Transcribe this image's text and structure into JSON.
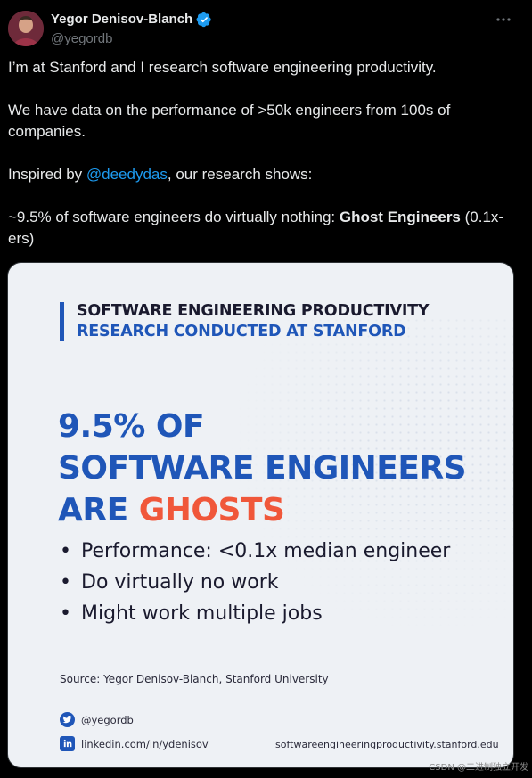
{
  "tweet": {
    "author": {
      "display_name": "Yegor Denisov-Blanch",
      "handle": "@yegordb",
      "verified": true
    },
    "text": {
      "line1": "I’m at Stanford and I research software engineering productivity.",
      "line2": "We have data on the performance of >50k engineers from 100s of companies.",
      "line3_prefix": "Inspired by ",
      "line3_mention": "@deedydas",
      "line3_suffix": ", our research shows:",
      "line4_prefix": "~9.5% of software engineers do virtually nothing: ",
      "line4_bold": "Ghost Engineers",
      "line4_suffix": " (0.1x-ers)"
    }
  },
  "media": {
    "header_line1": "SOFTWARE ENGINEERING PRODUCTIVITY",
    "header_line2": "RESEARCH CONDUCTED AT STANFORD",
    "big_line1": "9.5% OF",
    "big_line2": "SOFTWARE ENGINEERS",
    "big_line3_prefix": "ARE ",
    "big_line3_highlight": "GHOSTS",
    "bullets": [
      "Performance: <0.1x median engineer",
      "Do virtually no work",
      "Might work multiple jobs"
    ],
    "source": "Source: Yegor Denisov-Blanch, Stanford University",
    "twitter_handle": "@yegordb",
    "linkedin": "linkedin.com/in/ydenisov",
    "website": "softwareengineeringproductivity.stanford.edu"
  },
  "watermark": "CSDN @二进制独立开发",
  "colors": {
    "background": "#000000",
    "text": "#e7e9ea",
    "muted": "#71767b",
    "link": "#1d9bf0",
    "verified": "#1d9bf0",
    "media_blue": "#1f56b8",
    "media_orange": "#f0573a",
    "media_bg": "#eef1f5"
  }
}
